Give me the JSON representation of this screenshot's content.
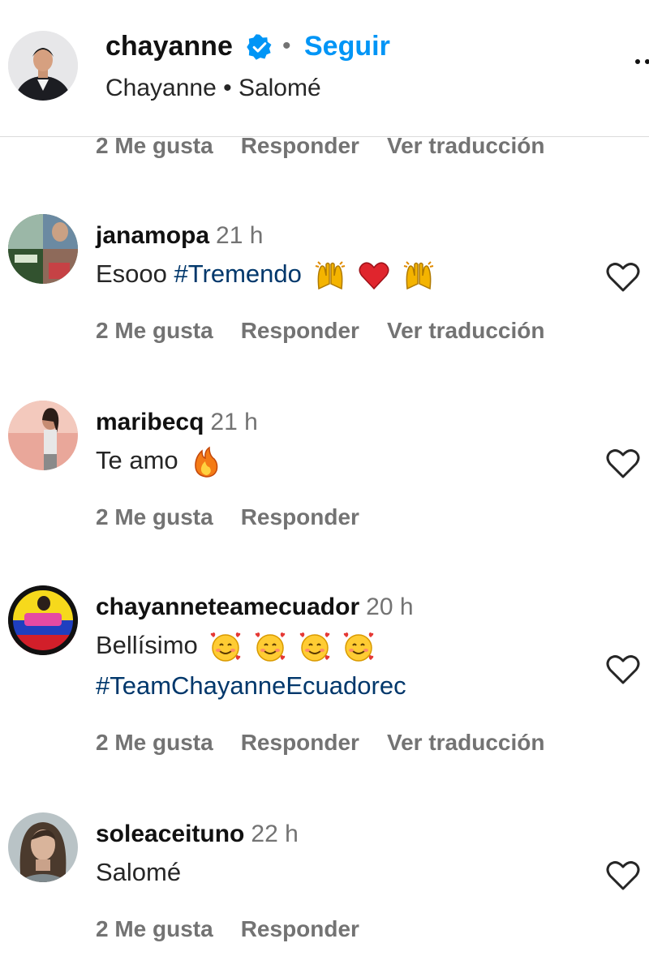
{
  "header": {
    "username": "chayanne",
    "dot": "•",
    "follow_label": "Seguir",
    "subtitle": "Chayanne • Salomé"
  },
  "top_actions": {
    "likes": "2 Me gusta",
    "reply": "Responder",
    "translate": "Ver traducción"
  },
  "comments": [
    {
      "username": "janamopa",
      "time": "21 h",
      "text": "Esooo ",
      "hashtag": "#Tremendo",
      "emojis": [
        "raising-hands",
        "red-heart",
        "raising-hands"
      ],
      "likes": "2 Me gusta",
      "reply": "Responder",
      "translate": "Ver traducción"
    },
    {
      "username": "maribecq",
      "time": "21 h",
      "text": "Te amo",
      "emojis": [
        "fire"
      ],
      "likes": "2 Me gusta",
      "reply": "Responder"
    },
    {
      "username": "chayanneteamecuador",
      "time": "20 h",
      "text": "Bellísimo",
      "emojis": [
        "smiling-face-with-hearts",
        "smiling-face-with-hearts",
        "smiling-face-with-hearts",
        "smiling-face-with-hearts"
      ],
      "hashtag_line2": "#TeamChayanneEcuadorec",
      "likes": "2 Me gusta",
      "reply": "Responder",
      "translate": "Ver traducción"
    },
    {
      "username": "soleaceituno",
      "time": "22 h",
      "text": "Salomé",
      "likes": "2 Me gusta",
      "reply": "Responder"
    }
  ],
  "colors": {
    "link_blue": "#0095f6",
    "hashtag": "#00376b",
    "muted": "#737373",
    "verified": "#0095f6"
  }
}
